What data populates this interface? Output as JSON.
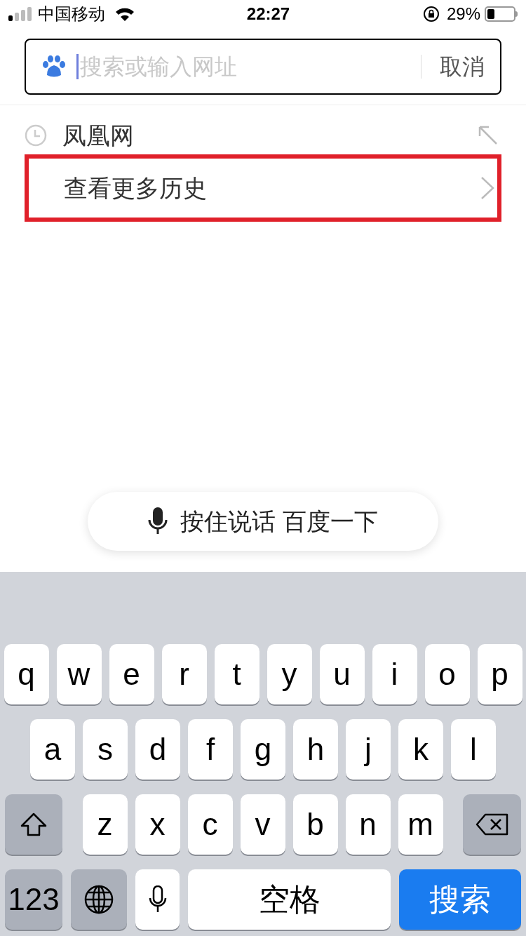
{
  "status_bar": {
    "carrier": "中国移动",
    "time": "22:27",
    "battery": "29%"
  },
  "search": {
    "placeholder": "搜索或输入网址",
    "cancel": "取消"
  },
  "history": [
    {
      "kind": "entry",
      "label": "凤凰网",
      "highlighted": false
    },
    {
      "kind": "more",
      "label": "查看更多历史",
      "highlighted": true
    }
  ],
  "voice_button": "按住说话 百度一下",
  "keyboard": {
    "rows": [
      [
        "q",
        "w",
        "e",
        "r",
        "t",
        "y",
        "u",
        "i",
        "o",
        "p"
      ],
      [
        "a",
        "s",
        "d",
        "f",
        "g",
        "h",
        "j",
        "k",
        "l"
      ],
      [
        "z",
        "x",
        "c",
        "v",
        "b",
        "n",
        "m"
      ]
    ],
    "numbers_key": "123",
    "space_key": "空格",
    "search_key": "搜索"
  }
}
